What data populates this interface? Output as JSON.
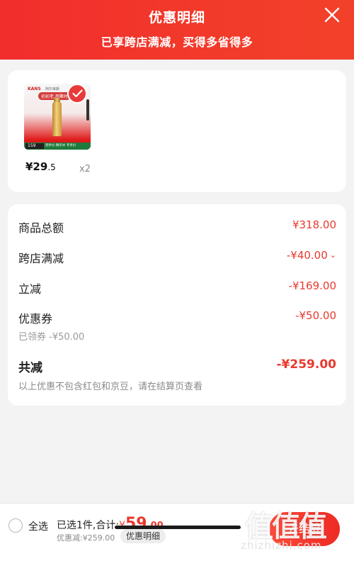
{
  "header": {
    "title": "优惠明细",
    "subtitle": "已享跨店满减，买得多省得多"
  },
  "product": {
    "thumb_brand": "KANS",
    "thumb_brand2": "韩束",
    "thumb_store": "阿尔卑斯",
    "thumb_tag": "初初老,用聚时",
    "thumb_price": "159",
    "thumb_band": "到手价 精华水 专享价",
    "price_int": "¥29",
    "price_dec": ".5",
    "quantity": "x2"
  },
  "summary": {
    "rows": [
      {
        "label": "商品总额",
        "value": "¥318.00"
      },
      {
        "label": "跨店满减",
        "value": "-¥40.00",
        "chevron": "⌄"
      },
      {
        "label": "立减",
        "value": "-¥169.00"
      },
      {
        "label": "优惠券",
        "value": "-¥50.00",
        "sub": "已领券 -¥50.00"
      }
    ],
    "total": {
      "label": "共减",
      "value": "-¥259.00"
    },
    "note": "以上优惠不包含红包和京豆，请在结算页查看"
  },
  "bottom_bar": {
    "select_all": "全选",
    "selected_text": "已选1件,合计:",
    "total_yen": "¥",
    "total_int": "59",
    "total_dec": ".00",
    "discount_text": "优惠减:¥259.00",
    "detail_button": "优惠明细",
    "checkout_label": "去结算"
  },
  "watermark": {
    "text": "值值值",
    "url": "zhizhizhi.com"
  },
  "colors": {
    "header_red": "#f22d2d",
    "price_red": "#e8392e"
  }
}
